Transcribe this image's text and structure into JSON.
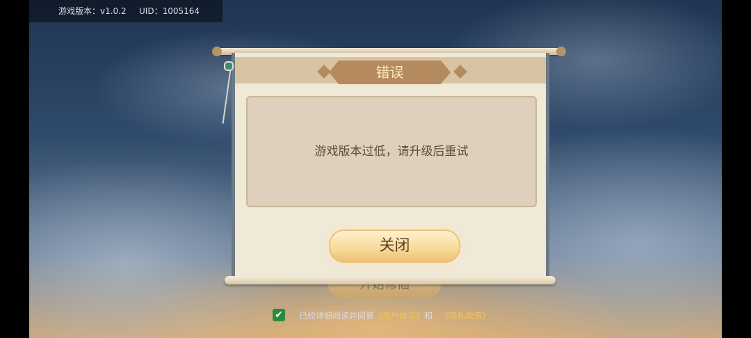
{
  "header": {
    "version_text": "游戏版本：v1.0.2",
    "uid_text": "UID：1005164"
  },
  "background": {
    "start_button_label": "开始修仙"
  },
  "agreement": {
    "checkbox_mark": "✔",
    "text_prefix": "已经详细阅读并同意",
    "user_agreement_link": "《用户协议》",
    "and_text": "和",
    "privacy_link": "《隐私政策》"
  },
  "dialog": {
    "title": "错误",
    "message": "游戏版本过低，请升级后重试",
    "close_label": "关闭"
  },
  "colors": {
    "accent": "#b58a5e",
    "panel": "#f1e9d7",
    "button": "#f7d997",
    "link": "#f0c65c"
  }
}
